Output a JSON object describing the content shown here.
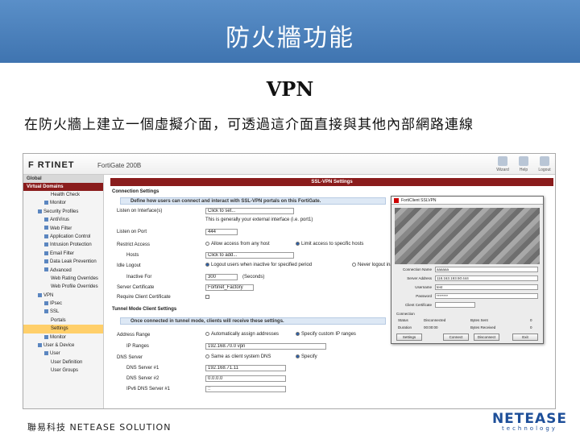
{
  "slide": {
    "title": "防火牆功能",
    "subtitle": "VPN",
    "description": "在防火牆上建立一個虛擬介面，可透過這介面直接與其他內部網路連線",
    "footer_left": "聯易科技  NETEASE SOLUTION",
    "footer_brand": "NETEASE",
    "footer_brand_sub": "technology"
  },
  "app": {
    "logo": "F RTINET",
    "model": "FortiGate 200B",
    "toolbar": [
      "Wizard",
      "Help",
      "Logout"
    ]
  },
  "sidebar": {
    "sections": [
      "Global",
      "Virtual Domains"
    ],
    "items": [
      "Health Check",
      "Monitor",
      "Security Profiles",
      "AntiVirus",
      "Web Filter",
      "Application Control",
      "Intrusion Protection",
      "Email Filter",
      "Data Leak Prevention",
      "Advanced",
      "Web Rating Overrides",
      "Web Profile Overrides",
      "VPN",
      "IPsec",
      "SSL",
      "Portals",
      "Settings",
      "Monitor",
      "User & Device",
      "User",
      "User Definition",
      "User Groups"
    ],
    "selected": "Settings"
  },
  "main": {
    "panel_title": "SSL-VPN Settings",
    "connection_settings": "Connection Settings",
    "connection_band": "Define how users can connect and interact with SSL-VPN portals on this FortiGate.",
    "listen_on_interface_label": "Listen on Interface(s)",
    "listen_on_interface_value": "Click to set...",
    "listen_note": "This is generally your external interface (i.e. port1)",
    "listen_on_port_label": "Listen on Port",
    "listen_on_port_value": "444",
    "restrict_access_label": "Restrict Access",
    "restrict_opt1": "Allow access from any host",
    "restrict_opt2": "Limit access to specific hosts",
    "hosts_label": "Hosts",
    "hosts_value": "Click to add...",
    "idle_logout_label": "Idle Logout",
    "idle_opt1": "Logout users when inactive for specified period",
    "idle_opt2": "Never logout inactive",
    "inactive_for_label": "Inactive For",
    "inactive_for_value": "300",
    "inactive_for_unit": "(Seconds)",
    "server_cert_label": "Server Certificate",
    "server_cert_value": "Fortinet_Factory",
    "require_cert_label": "Require Client Certificate",
    "tunnel_settings": "Tunnel Mode Client Settings",
    "tunnel_band": "Once connected in tunnel mode, clients will receive these settings.",
    "address_range_label": "Address Range",
    "addr_opt1": "Automatically assign addresses",
    "addr_opt2": "Specify custom IP ranges",
    "ip_ranges_label": "IP Ranges",
    "ip_ranges_value": "192.168.70.0 vpn",
    "dns_server_label": "DNS Server",
    "dns_opt1": "Same as client system DNS",
    "dns_opt2": "Specify",
    "dns1_label": "DNS Server #1",
    "dns1_value": "192.168.71.11",
    "dns2_label": "DNS Server #2",
    "dns2_value": "0.0.0.0",
    "ipv6dns1_label": "IPv6 DNS Server #1",
    "ipv6dns1_value": "::"
  },
  "dialog": {
    "title": "FortiClient SSLVPN",
    "connection_name_label": "Connection Name",
    "connection_name_value": "aaaaaa",
    "server_address_label": "Server Address",
    "server_address_value": "118.163.193.50:444",
    "username_label": "Username",
    "username_value": "test",
    "password_label": "Password",
    "password_value": "********",
    "client_cert_label": "Client Certificate",
    "connection_group": "Connection",
    "status_label": "Status",
    "status_value": "Disconnected",
    "bytes_sent_label": "Bytes Sent",
    "bytes_sent_value": "0",
    "duration_label": "Duration",
    "duration_value": "00:00:00",
    "bytes_received_label": "Bytes Received",
    "bytes_received_value": "0",
    "buttons": [
      "Settings",
      "Connect",
      "Disconnect",
      "Exit"
    ]
  }
}
